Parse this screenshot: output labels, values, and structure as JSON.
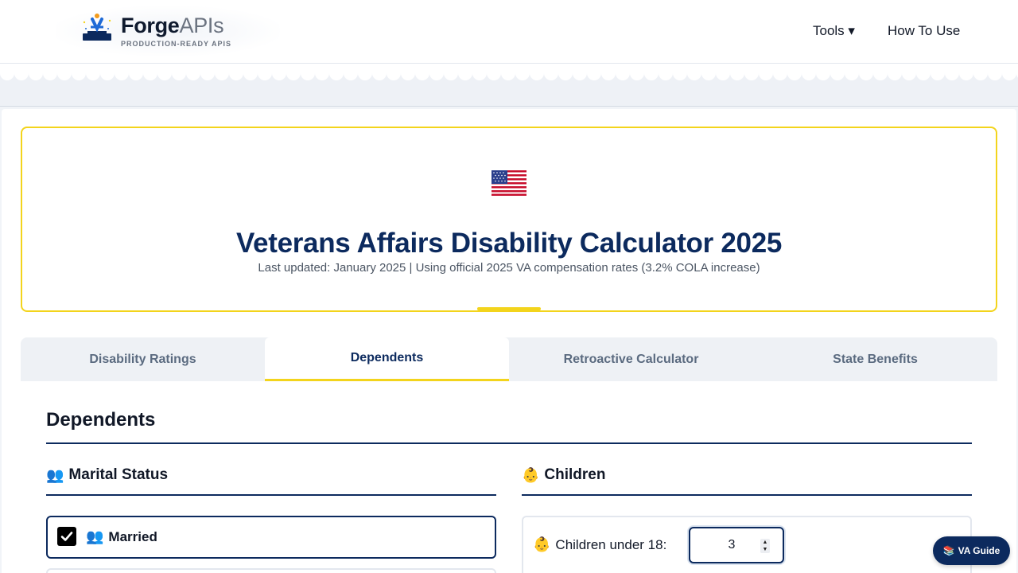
{
  "header": {
    "brand_name_bold": "Forge",
    "brand_name_light": "APIs",
    "brand_tagline": "PRODUCTION-READY APIS",
    "nav_tools": "Tools ▾",
    "nav_how_to_use": "How To Use"
  },
  "hero": {
    "flag_icon": "us-flag-icon",
    "title": "Veterans Affairs Disability Calculator 2025",
    "subtitle": "Last updated: January 2025 | Using official 2025 VA compensation rates (3.2% COLA increase)"
  },
  "tabs": [
    {
      "label": "Disability Ratings",
      "active": false
    },
    {
      "label": "Dependents",
      "active": true
    },
    {
      "label": "Retroactive Calculator",
      "active": false
    },
    {
      "label": "State Benefits",
      "active": false
    }
  ],
  "section": {
    "title": "Dependents",
    "marital": {
      "icon": "👥",
      "title": "Marital Status",
      "married_checked": true,
      "married_icon": "👥",
      "married_label": "Married"
    },
    "children": {
      "icon": "👶",
      "title": "Children",
      "under18_icon": "👶",
      "under18_label": "Children under 18:",
      "under18_value": "3"
    }
  },
  "floating": {
    "icon": "📚",
    "label": "VA Guide"
  },
  "colors": {
    "navy": "#0c2a5e",
    "accent_yellow": "#f3d41c",
    "tab_bg": "#eef1f5"
  }
}
